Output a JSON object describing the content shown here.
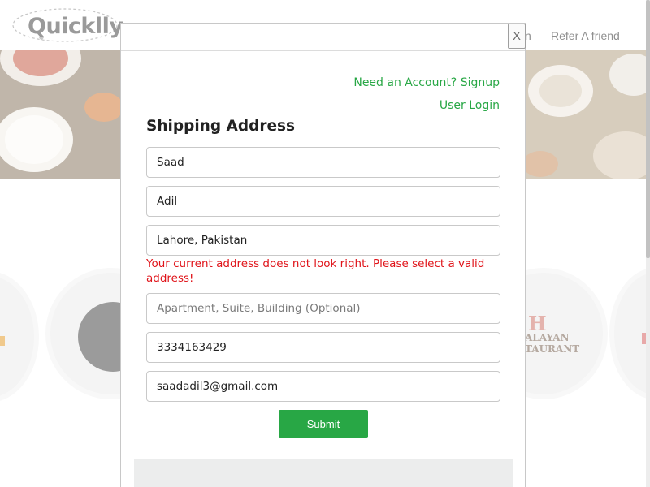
{
  "header": {
    "logo_text": "Quicklly",
    "nav_partial_label": "n",
    "nav_refer_label": "Refer A friend"
  },
  "background_logos": {
    "himalayan_initial": "H",
    "himalayan_line1": "ALAYAN",
    "himalayan_line2": "TAURANT"
  },
  "modal": {
    "close_label": "X",
    "signup_link": "Need an Account? Signup",
    "login_link": "User Login",
    "title": "Shipping Address",
    "fields": {
      "first_name": {
        "value": "Saad",
        "placeholder": ""
      },
      "last_name": {
        "value": "Adil",
        "placeholder": ""
      },
      "address": {
        "value": "Lahore, Pakistan",
        "placeholder": ""
      },
      "apartment": {
        "value": "",
        "placeholder": "Apartment, Suite, Building (Optional)"
      },
      "phone": {
        "value": "3334163429",
        "placeholder": ""
      },
      "email": {
        "value": "saadadil3@gmail.com",
        "placeholder": ""
      }
    },
    "address_error": "Your current address does not look right. Please select a valid address!",
    "submit_label": "Submit"
  },
  "colors": {
    "accent_green": "#28a745",
    "error_red": "#e0141a",
    "logo_gray": "#9a9a9a"
  }
}
